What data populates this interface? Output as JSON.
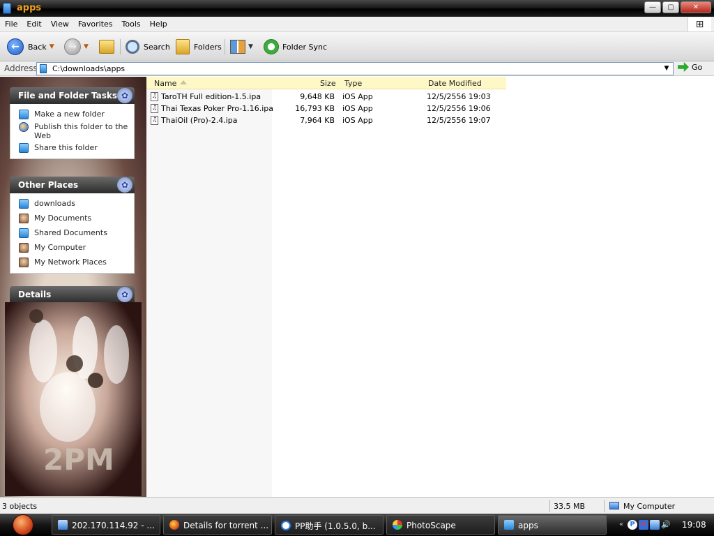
{
  "window": {
    "title": "apps",
    "minimize_glyph": "—",
    "restore_glyph": "▢",
    "close_glyph": "✕",
    "logo_glyph": "⊞"
  },
  "menu": [
    "File",
    "Edit",
    "View",
    "Favorites",
    "Tools",
    "Help"
  ],
  "toolbar": {
    "back_label": "Back",
    "back_glyph": "←",
    "forward_glyph": "→",
    "dropdown_glyph": "▼",
    "search_label": "Search",
    "folders_label": "Folders",
    "folder_sync_label": "Folder Sync"
  },
  "address": {
    "label": "Address",
    "value": "C:\\downloads\\apps",
    "go_label": "Go"
  },
  "sidebar": {
    "paw_glyph": "✿",
    "file_tasks": {
      "title": "File and Folder Tasks",
      "items": [
        "Make a new folder",
        "Publish this folder to the Web",
        "Share this folder"
      ]
    },
    "other_places": {
      "title": "Other Places",
      "items": [
        "downloads",
        "My Documents",
        "Shared Documents",
        "My Computer",
        "My Network Places"
      ]
    },
    "details": {
      "title": "Details",
      "image_text": "2PM"
    }
  },
  "file_list": {
    "columns": [
      "Name",
      "Size",
      "Type",
      "Date Modified"
    ],
    "file_glyph": "♫",
    "rows": [
      {
        "name": "TaroTH Full edition-1.5.ipa",
        "size": "9,648 KB",
        "type": "iOS App",
        "modified": "12/5/2556 19:03"
      },
      {
        "name": "Thai Texas Poker Pro-1.16.ipa",
        "size": "16,793 KB",
        "type": "iOS App",
        "modified": "12/5/2556 19:06"
      },
      {
        "name": "ThaiOil (Pro)-2.4.ipa",
        "size": "7,964 KB",
        "type": "iOS App",
        "modified": "12/5/2556 19:07"
      }
    ]
  },
  "status": {
    "objects": "3 objects",
    "size": "33.5 MB",
    "location": "My Computer"
  },
  "taskbar": {
    "buttons": [
      "202.170.114.92 - ...",
      "Details for torrent ...",
      "PP助手 (1.0.5.0, b...",
      "PhotoScape",
      "apps"
    ],
    "clock": "19:08",
    "tray_glyph_chevron": "«",
    "tray_glyph_pp": "P",
    "tray_glyph_network": "✕",
    "tray_glyph_volume": "🔊"
  }
}
